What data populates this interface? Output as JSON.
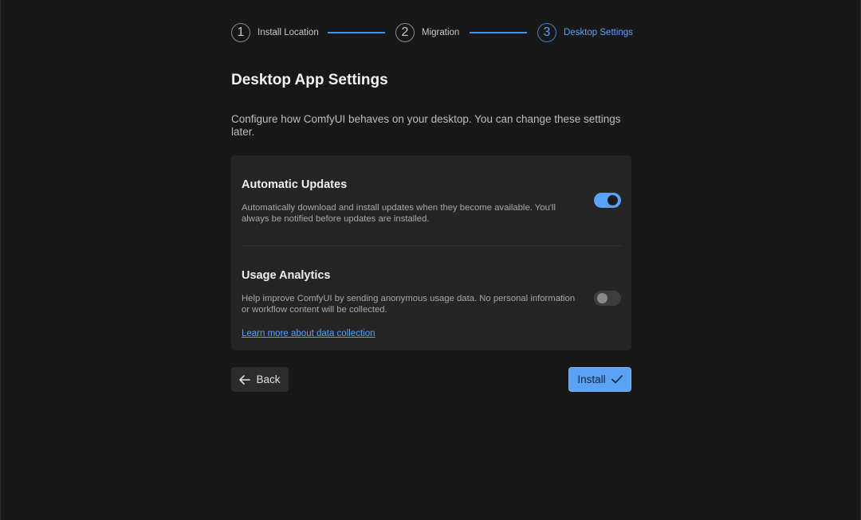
{
  "stepper": {
    "steps": [
      {
        "number": "1",
        "label": "Install Location",
        "state": "complete"
      },
      {
        "number": "2",
        "label": "Migration",
        "state": "complete"
      },
      {
        "number": "3",
        "label": "Desktop Settings",
        "state": "active"
      }
    ]
  },
  "header": {
    "title": "Desktop App Settings",
    "subtitle": "Configure how ComfyUI behaves on your desktop. You can change these settings later."
  },
  "settings": {
    "auto_updates": {
      "title": "Automatic Updates",
      "description": "Automatically download and install updates when they become available. You'll always be notified before updates are installed.",
      "enabled": true
    },
    "usage_analytics": {
      "title": "Usage Analytics",
      "description": "Help improve ComfyUI by sending anonymous usage data. No personal information or workflow content will be collected.",
      "enabled": false,
      "link_text": "Learn more about data collection"
    }
  },
  "footer": {
    "back_label": "Back",
    "install_label": "Install"
  },
  "colors": {
    "accent": "#5aa2f5",
    "background": "#181818",
    "card": "#252525"
  },
  "icons": {
    "back": "arrow-left-icon",
    "install": "checkmark-icon"
  }
}
